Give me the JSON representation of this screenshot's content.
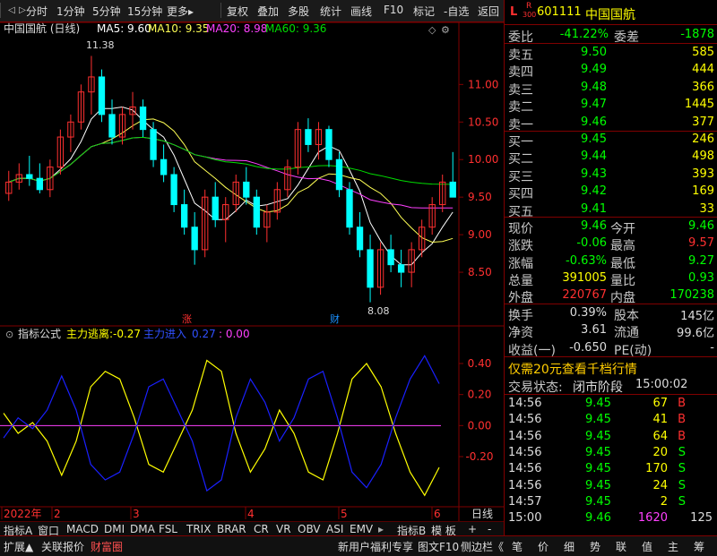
{
  "toolbar": {
    "items": [
      "分时",
      "1分钟",
      "5分钟",
      "15分钟",
      "更多",
      "复权",
      "叠加",
      "多股",
      "统计",
      "画线",
      "F10",
      "标记",
      "-自选",
      "返回"
    ],
    "more_arrow": "▸"
  },
  "nav": {
    "prev": "◁",
    "next": "▷",
    "zoom_in": "▲",
    "zoom_out": "▼"
  },
  "chart": {
    "legend": {
      "title": "中国国航 (日线)",
      "ma5": "MA5: 9.60",
      "ma10": "MA10: 9.35",
      "ma20": "MA20: 8.98",
      "ma60": "MA60: 9.36"
    },
    "price_ticks": [
      "11.00",
      "10.50",
      "10.00",
      "9.50",
      "9.00",
      "8.50"
    ],
    "high_label": "11.38",
    "low_label": "8.08",
    "markers": [
      "涨",
      "财"
    ],
    "indicator": {
      "title": "指标公式",
      "s1_label": "主力逃离:",
      "s1_value": "-0.27",
      "s2_label": "主力进入",
      "s2_value": "0.27",
      "s3_value": ": 0.00",
      "ticks": [
        "0.40",
        "0.20",
        "0.00",
        "-0.20"
      ]
    },
    "dates": [
      "2022年",
      "2",
      "3",
      "4",
      "5",
      "6"
    ],
    "scale_label": "日线",
    "colors": {
      "up": "#ff3030",
      "down": "#00ffff",
      "ma5": "#ffffff",
      "ma10": "#ffff55",
      "ma20": "#ff40ff",
      "ma60": "#00dd00",
      "ind_yellow": "#ffff00",
      "ind_blue": "#1a20ff",
      "zero": "#ff40ff"
    }
  },
  "chart_data": [
    {
      "type": "candlestick",
      "title": "中国国航 (日线)",
      "ylim": [
        8.0,
        11.6
      ],
      "price_ticks": [
        11.0,
        10.5,
        10.0,
        9.5,
        9.0,
        8.5
      ],
      "annotations": {
        "high": 11.38,
        "low": 8.08
      },
      "candles": [
        [
          9.55,
          9.85,
          9.45,
          9.7
        ],
        [
          9.7,
          9.95,
          9.6,
          9.8
        ],
        [
          9.8,
          10.05,
          9.65,
          9.75
        ],
        [
          9.75,
          9.95,
          9.55,
          9.6
        ],
        [
          9.6,
          10.0,
          9.5,
          9.9
        ],
        [
          9.9,
          10.4,
          9.8,
          10.3
        ],
        [
          10.3,
          10.6,
          10.1,
          10.5
        ],
        [
          10.5,
          11.0,
          10.4,
          10.9
        ],
        [
          10.9,
          11.38,
          10.6,
          11.1
        ],
        [
          11.1,
          11.2,
          10.5,
          10.6
        ],
        [
          10.6,
          10.8,
          10.2,
          10.3
        ],
        [
          10.3,
          10.7,
          10.2,
          10.6
        ],
        [
          10.6,
          10.9,
          10.4,
          10.7
        ],
        [
          10.7,
          10.8,
          10.3,
          10.4
        ],
        [
          10.4,
          10.5,
          9.9,
          10.0
        ],
        [
          10.0,
          10.2,
          9.7,
          9.8
        ],
        [
          9.8,
          9.9,
          9.3,
          9.4
        ],
        [
          9.4,
          9.6,
          9.0,
          9.1
        ],
        [
          9.1,
          9.3,
          8.6,
          8.8
        ],
        [
          8.8,
          9.6,
          8.7,
          9.5
        ],
        [
          9.5,
          9.7,
          9.1,
          9.2
        ],
        [
          9.2,
          9.5,
          8.9,
          9.4
        ],
        [
          9.4,
          9.8,
          9.3,
          9.7
        ],
        [
          9.7,
          9.9,
          9.4,
          9.5
        ],
        [
          9.5,
          9.6,
          9.0,
          9.1
        ],
        [
          9.1,
          9.4,
          8.9,
          9.3
        ],
        [
          9.3,
          9.7,
          9.2,
          9.6
        ],
        [
          9.6,
          10.0,
          9.5,
          9.9
        ],
        [
          9.9,
          10.5,
          9.8,
          10.4
        ],
        [
          10.4,
          10.55,
          10.1,
          10.2
        ],
        [
          10.2,
          10.5,
          10.0,
          10.4
        ],
        [
          10.4,
          10.45,
          9.9,
          10.0
        ],
        [
          10.0,
          10.1,
          9.5,
          9.6
        ],
        [
          9.6,
          9.7,
          9.0,
          9.1
        ],
        [
          9.1,
          9.3,
          8.7,
          8.8
        ],
        [
          8.8,
          9.0,
          8.1,
          8.3
        ],
        [
          8.3,
          8.9,
          8.2,
          8.8
        ],
        [
          8.8,
          9.0,
          8.5,
          8.6
        ],
        [
          8.6,
          8.8,
          8.3,
          8.5
        ],
        [
          8.5,
          8.9,
          8.3,
          8.8
        ],
        [
          8.8,
          9.2,
          8.7,
          9.1
        ],
        [
          9.1,
          9.5,
          9.0,
          9.4
        ],
        [
          9.4,
          9.8,
          9.3,
          9.7
        ],
        [
          9.7,
          10.1,
          9.6,
          9.5
        ]
      ],
      "ma": [
        {
          "name": "MA5",
          "value": 9.6
        },
        {
          "name": "MA10",
          "value": 9.35
        },
        {
          "name": "MA20",
          "value": 8.98
        },
        {
          "name": "MA60",
          "value": 9.36
        }
      ]
    },
    {
      "type": "line",
      "title": "指标公式",
      "ylim": [
        -0.5,
        0.55
      ],
      "ticks": [
        0.4,
        0.2,
        0.0,
        -0.2
      ],
      "series": [
        {
          "name": "主力逃离",
          "values": [
            0.08,
            -0.05,
            0.02,
            -0.1,
            -0.32,
            -0.1,
            0.25,
            0.35,
            0.3,
            0.05,
            -0.25,
            -0.3,
            -0.1,
            0.1,
            0.42,
            0.35,
            -0.05,
            -0.3,
            -0.15,
            0.1,
            -0.05,
            -0.3,
            -0.35,
            -0.05,
            0.3,
            0.4,
            0.25,
            -0.05,
            -0.3,
            -0.45,
            -0.27
          ]
        },
        {
          "name": "主力进入",
          "values": [
            -0.08,
            0.05,
            -0.02,
            0.1,
            0.32,
            0.1,
            -0.25,
            -0.35,
            -0.3,
            -0.05,
            0.25,
            0.3,
            0.1,
            -0.1,
            -0.42,
            -0.35,
            0.05,
            0.3,
            0.15,
            -0.1,
            0.05,
            0.3,
            0.35,
            0.05,
            -0.3,
            -0.4,
            -0.25,
            0.05,
            0.3,
            0.45,
            0.27
          ]
        }
      ]
    }
  ],
  "quote": {
    "code": "601111",
    "name": "中国国航",
    "prefix": "L",
    "sub": "R",
    "sub2": "300",
    "weibi_label": "委比",
    "weibi": "-41.22%",
    "weicha_label": "委差",
    "weicha": "-1878",
    "asks": [
      {
        "l": "卖五",
        "p": "9.50",
        "v": "585"
      },
      {
        "l": "卖四",
        "p": "9.49",
        "v": "444"
      },
      {
        "l": "卖三",
        "p": "9.48",
        "v": "366"
      },
      {
        "l": "卖二",
        "p": "9.47",
        "v": "1445"
      },
      {
        "l": "卖一",
        "p": "9.46",
        "v": "377"
      }
    ],
    "bids": [
      {
        "l": "买一",
        "p": "9.45",
        "v": "246"
      },
      {
        "l": "买二",
        "p": "9.44",
        "v": "498"
      },
      {
        "l": "买三",
        "p": "9.43",
        "v": "393"
      },
      {
        "l": "买四",
        "p": "9.42",
        "v": "169"
      },
      {
        "l": "买五",
        "p": "9.41",
        "v": "33"
      }
    ],
    "stats": [
      {
        "l1": "现价",
        "v1": "9.46",
        "c1": "#00ff00",
        "l2": "今开",
        "v2": "9.46",
        "c2": "#00ff00"
      },
      {
        "l1": "涨跌",
        "v1": "-0.06",
        "c1": "#00ff00",
        "l2": "最高",
        "v2": "9.57",
        "c2": "#ff3030"
      },
      {
        "l1": "涨幅",
        "v1": "-0.63%",
        "c1": "#00ff00",
        "l2": "最低",
        "v2": "9.27",
        "c2": "#00ff00"
      },
      {
        "l1": "总量",
        "v1": "391005",
        "c1": "#ffff00",
        "l2": "量比",
        "v2": "0.93",
        "c2": "#00ff00"
      },
      {
        "l1": "外盘",
        "v1": "220767",
        "c1": "#ff3030",
        "l2": "内盘",
        "v2": "170238",
        "c2": "#00ff00"
      }
    ],
    "fund": [
      {
        "l1": "换手",
        "v1": "0.39%",
        "l2": "股本",
        "v2": "145亿"
      },
      {
        "l1": "净资",
        "v1": "3.61",
        "l2": "流通",
        "v2": "99.6亿"
      },
      {
        "l1": "收益(一)",
        "v1": "-0.650",
        "l2": "PE(动)",
        "v2": "-"
      }
    ],
    "promo": "仅需20元查看千档行情",
    "status_label": "交易状态:",
    "status_value": "闭市阶段",
    "status_time": "15:00:02",
    "ticks": [
      {
        "t": "14:56",
        "p": "9.45",
        "v": "67",
        "bs": "B"
      },
      {
        "t": "14:56",
        "p": "9.45",
        "v": "41",
        "bs": "B"
      },
      {
        "t": "14:56",
        "p": "9.45",
        "v": "64",
        "bs": "B"
      },
      {
        "t": "14:56",
        "p": "9.45",
        "v": "20",
        "bs": "S"
      },
      {
        "t": "14:56",
        "p": "9.45",
        "v": "170",
        "bs": "S"
      },
      {
        "t": "14:56",
        "p": "9.45",
        "v": "24",
        "bs": "S"
      },
      {
        "t": "14:57",
        "p": "9.45",
        "v": "2",
        "bs": "S"
      },
      {
        "t": "15:00",
        "p": "9.46",
        "v": "1620",
        "bs": "",
        "extra": "125"
      }
    ]
  },
  "indicator_bar": {
    "items": [
      "指标A",
      "窗口",
      "MACD",
      "DMI",
      "DMA",
      "FSL",
      "TRIX",
      "BRAR",
      "CR",
      "VR",
      "OBV",
      "ASI",
      "EMV"
    ],
    "right": [
      "指标B",
      "模 板",
      "+",
      "-"
    ],
    "arrow": "▸"
  },
  "bottom": {
    "left": [
      "扩展▲",
      "关联报价",
      "财富圈"
    ],
    "mid": [
      "新用户福利专享",
      "图文F10",
      "侧边栏《"
    ],
    "right": [
      "笔",
      "价",
      "细",
      "势",
      "联",
      "值",
      "主",
      "筹"
    ]
  }
}
